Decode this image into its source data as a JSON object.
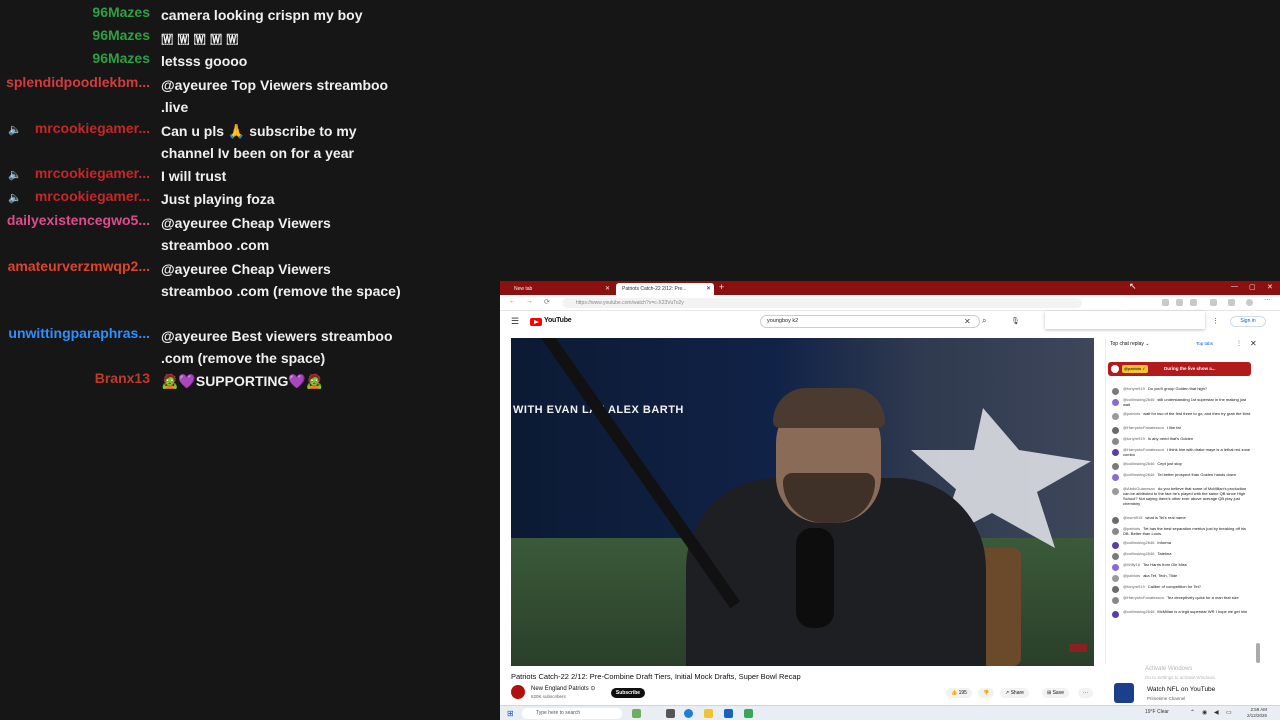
{
  "chat": [
    {
      "user": "96Mazes",
      "color": "#2ea043",
      "message": "camera looking crispn my boy",
      "speaker": false
    },
    {
      "user": "96Mazes",
      "color": "#2ea043",
      "message": "🇼 🇼 🇼 🇼 🇼",
      "speaker": false
    },
    {
      "user": "96Mazes",
      "color": "#2ea043",
      "message": "letsss goooo",
      "speaker": false
    },
    {
      "user": "splendidpoodlekbm...",
      "color": "#d63b3b",
      "message": "@ayeuree Top Viewers streamboo .live",
      "speaker": false
    },
    {
      "user": "mrcookiegamer...",
      "color": "#c72626",
      "message": "Can u pls 🙏 subscribe to my channel Iv been on for a year",
      "speaker": true
    },
    {
      "user": "mrcookiegamer...",
      "color": "#c72626",
      "message": "I will trust",
      "speaker": true
    },
    {
      "user": "mrcookiegamer...",
      "color": "#c72626",
      "message": "Just playing foza",
      "speaker": true
    },
    {
      "user": "dailyexistencegwo5...",
      "color": "#e04b8c",
      "message": "@ayeuree Cheap Viewers streamboo .com",
      "speaker": false
    },
    {
      "user": "amateurverzmwqp2...",
      "color": "#e0422a",
      "message": "@ayeuree Cheap Viewers streamboo .com (remove the space)",
      "speaker": false
    },
    {
      "user": "unwittingparaphras...",
      "color": "#2f8fff",
      "message": "@ayeuree Best viewers streamboo .com (remove the space)",
      "speaker": false
    },
    {
      "user": "Branx13",
      "color": "#c0392b",
      "message": "🧟💜SUPPORTING💜🧟",
      "speaker": false
    }
  ],
  "browser": {
    "tabs": [
      "New tab",
      "Patriots Catch-22 2/12: Pre..."
    ],
    "url": "https://www.youtube.com/watch?v=c-X23VuTo2y",
    "window_controls": [
      "—",
      "▢",
      "✕"
    ]
  },
  "youtube": {
    "brand": "YouTube",
    "search_value": "youngboy k2",
    "sign_in": "Sign in",
    "player_banner": "WITH EVAN LAZ    ALEX BARTH",
    "video_title": "Patriots Catch-22 2/12: Pre-Combine Draft Tiers, Initial Mock Drafts, Super Bowl Recap",
    "channel_name": "New England Patriots ⊙",
    "channel_subs": "620K subscribers",
    "subscribe": "Subscribe",
    "actions": [
      "👍 195",
      "👎",
      "↗ Share",
      "⊞ Save",
      "···"
    ],
    "promo_title": "Watch NFL on YouTube",
    "promo_sub": "Primetime Channel"
  },
  "live_chat": {
    "header": "Top chat replay ⌄",
    "top_tabs": "Top tabs",
    "pinned_name": "@patriots ✓",
    "pinned_text": "During the live show a...",
    "messages": [
      {
        "author": "@tonyre919",
        "text": "Do you'll group Golden that high?"
      },
      {
        "author": "@collinsking2646",
        "text": "still understanding 1st superstar in the making just wait"
      },
      {
        "author": "@patriots",
        "text": "wait for two of the first three to go, and then try grab the third"
      },
      {
        "author": "@HarryshcFanatesson",
        "text": "I like fat"
      },
      {
        "author": "@tonyre919",
        "text": "Is any need that's Golden"
      },
      {
        "author": "@HarryshcFanatesson",
        "text": "I think him with drake maye is a lethal red zone combo"
      },
      {
        "author": "@collinsking2646",
        "text": "Cept just stop"
      },
      {
        "author": "@collinsking2646",
        "text": "Tel better prospect than Golden hands down"
      },
      {
        "author": "@AbdoGuanesan",
        "text": "do you believe that some of McMillan's production can be attributed to the fact he's played with the same QB since High School? Not saying there's other ever above average QB play just chemistry"
      },
      {
        "author": "@nsmt919",
        "text": "what is Tel's real name"
      },
      {
        "author": "@patriots",
        "text": "Tet has the best separation metrics just by breaking off his DB. Better than Louis."
      },
      {
        "author": "@collinsking2646",
        "text": "Informa"
      },
      {
        "author": "@collinsking2646",
        "text": "Tatelma"
      },
      {
        "author": "@Willy16",
        "text": "Tez Harris from Ole Miss"
      },
      {
        "author": "@patriots",
        "text": "aka Tet, Tech, Tilde"
      },
      {
        "author": "@tonyre919",
        "text": "Caliber of competition for Tet?"
      },
      {
        "author": "@HarryshcFanatesson",
        "text": "Tez deceptively quick for a man that size"
      },
      {
        "author": "@collinsking2646",
        "text": "McMillan is a legit superstar WR I hope we get him"
      }
    ]
  },
  "activate_windows": {
    "title": "Activate Windows",
    "sub": "Go to Settings to activate Windows."
  },
  "taskbar": {
    "search_placeholder": "Type here to search",
    "weather": "19°F  Clear",
    "time": "2:59 AM",
    "date": "2/12/2026"
  },
  "colors": {
    "tabstrip": "#8c1010",
    "youtube_red": "#ff0000",
    "chat_bg": "#161616"
  }
}
